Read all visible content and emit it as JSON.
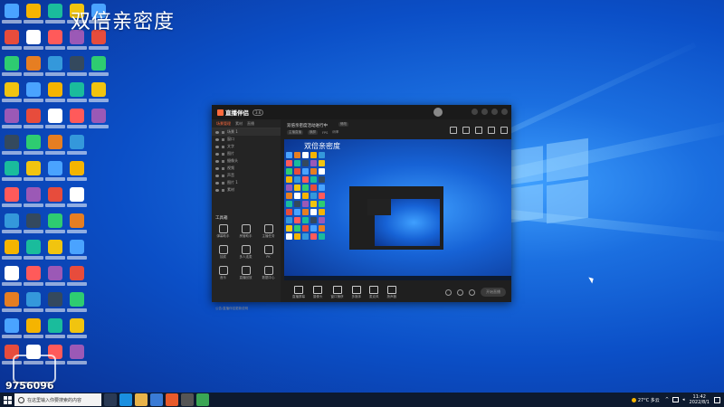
{
  "overlay_title": "双倍亲密度",
  "watermark": {
    "number": "9756096"
  },
  "taskbar": {
    "search_placeholder": "在这里输入你要搜索的内容",
    "weather": "27°C 多云",
    "time": "11:42",
    "date": "2022/8/1"
  },
  "app": {
    "name": "直播伴侣",
    "version": "3.6",
    "left_tabs": [
      {
        "label": "场景管理"
      },
      {
        "label": "素材"
      },
      {
        "label": "直播"
      }
    ],
    "scenes": [
      {
        "label": "场景 1"
      },
      {
        "label": "窗口"
      },
      {
        "label": "文字"
      },
      {
        "label": "图片"
      },
      {
        "label": "摄像头"
      },
      {
        "label": "视频"
      },
      {
        "label": "声音"
      },
      {
        "label": "图片 1"
      },
      {
        "label": "素材"
      }
    ],
    "tools_title": "工具箱",
    "tools": [
      {
        "label": "弹幕助手"
      },
      {
        "label": "房管助手"
      },
      {
        "label": "主播任务"
      },
      {
        "label": "抽奖"
      },
      {
        "label": "多人连麦"
      },
      {
        "label": "PK"
      },
      {
        "label": "音乐"
      },
      {
        "label": "直播回放"
      },
      {
        "label": "数据中心"
      }
    ],
    "bottom_note": "公告:直播伴侣更新说明",
    "room_title": "双倍亲密度活动进行中",
    "room_edit": "修改",
    "sub_row": [
      "主播直播",
      "横屏",
      "FPS",
      "码率"
    ],
    "controls": [
      {
        "label": "直播屏幕"
      },
      {
        "label": "摄像头"
      },
      {
        "label": "窗口捕获"
      },
      {
        "label": "多媒体"
      },
      {
        "label": "麦克风"
      },
      {
        "label": "扬声器"
      }
    ],
    "start_button": "开始直播"
  }
}
